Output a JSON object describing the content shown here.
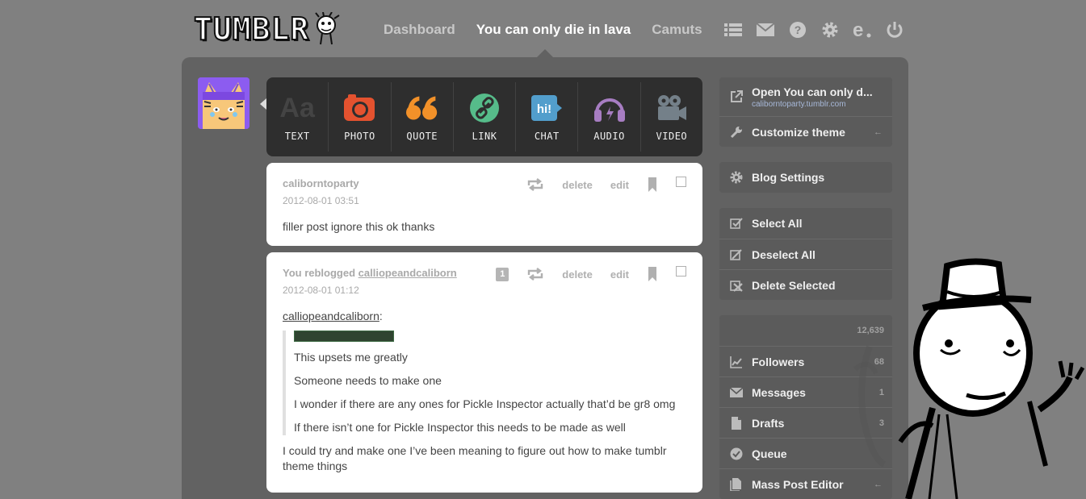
{
  "header": {
    "logo_text": "TUMBLR",
    "nav": {
      "dashboard": "Dashboard",
      "current_blog": "You can only die in lava",
      "second_blog": "Camuts"
    },
    "icons": [
      "list-icon",
      "mail-icon",
      "help-icon",
      "gear-icon",
      "e-icon",
      "power-icon"
    ]
  },
  "post_types": [
    {
      "name": "text",
      "label": "TEXT",
      "icon": "text-icon",
      "color": "#555555"
    },
    {
      "name": "photo",
      "label": "PHOTO",
      "icon": "camera-icon",
      "color": "#e4522f"
    },
    {
      "name": "quote",
      "label": "QUOTE",
      "icon": "quote-icon",
      "color": "#f29129"
    },
    {
      "name": "link",
      "label": "LINK",
      "icon": "link-icon",
      "color": "#56bc8a"
    },
    {
      "name": "chat",
      "label": "CHAT",
      "icon": "chat-icon",
      "color": "#529ecc"
    },
    {
      "name": "audio",
      "label": "AUDIO",
      "icon": "headphones-icon",
      "color": "#a77dc2"
    },
    {
      "name": "video",
      "label": "VIDEO",
      "icon": "video-camera-icon",
      "color": "#748089"
    }
  ],
  "posts": [
    {
      "author": "caliborntoparty",
      "date": "2012-08-01 03:51",
      "delete_label": "delete",
      "edit_label": "edit",
      "body": "filler post ignore this ok thanks"
    },
    {
      "author_prefix": "You reblogged ",
      "author_link": "calliopeandcaliborn",
      "note_count": "1",
      "date": "2012-08-01 01:12",
      "delete_label": "delete",
      "edit_label": "edit",
      "source_link": "calliopeandcaliborn",
      "source_suffix": ":",
      "quote_lines": [
        "This upsets me greatly",
        "Someone needs to make one",
        "I wonder if there are any ones for Pickle Inspector actually that’d be gr8 omg",
        "If there isn’t one for Pickle Inspector this needs to be made as well"
      ],
      "reply": "I could try and make one I’ve been meaning to figure out how to make tumblr theme things"
    }
  ],
  "sidebar": {
    "blog_group": {
      "open_label": "Open You can only d...",
      "open_url": "caliborntoparty.tumblr.com",
      "customize_label": "Customize theme",
      "customize_arrow": "←"
    },
    "settings_label": "Blog Settings",
    "mass_group": {
      "select_all": "Select All",
      "deselect_all": "Deselect All",
      "delete_selected": "Delete Selected"
    },
    "stats": {
      "posts_count": "12,639",
      "followers_label": "Followers",
      "followers_count": "68",
      "messages_label": "Messages",
      "messages_count": "1",
      "drafts_label": "Drafts",
      "drafts_count": "3",
      "queue_label": "Queue",
      "mass_editor_label": "Mass Post Editor",
      "mass_editor_arrow": "←"
    }
  }
}
